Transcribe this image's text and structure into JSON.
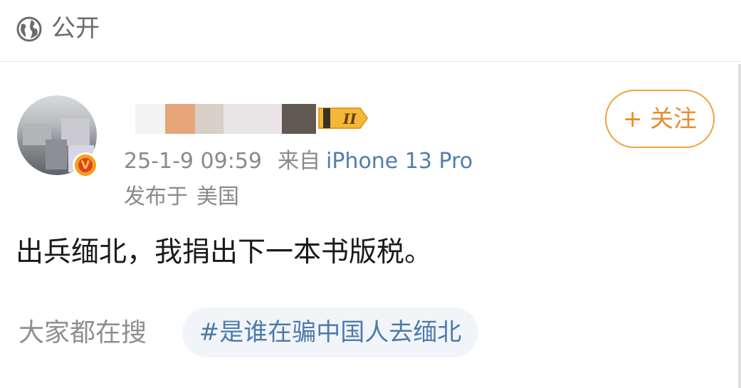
{
  "header": {
    "visibility_icon": "globe-icon",
    "visibility_label": "公开"
  },
  "post": {
    "author": {
      "avatar": "avatar-image",
      "verified_badge": "V",
      "level_badge": "II"
    },
    "timestamp": "25-1-9 09:59",
    "source_label": "来自",
    "device": "iPhone 13 Pro",
    "location_label": "发布于",
    "location_value": "美国",
    "follow_button": "+ 关注",
    "content": "出兵缅北，我捐出下一本书版税。"
  },
  "search": {
    "label": "大家都在搜",
    "hot_tag": "#是谁在骗中国人去缅北"
  },
  "colors": {
    "accent_orange": "#f2a23b",
    "link_blue": "#507daf",
    "tag_bg": "#f1f5fa"
  }
}
